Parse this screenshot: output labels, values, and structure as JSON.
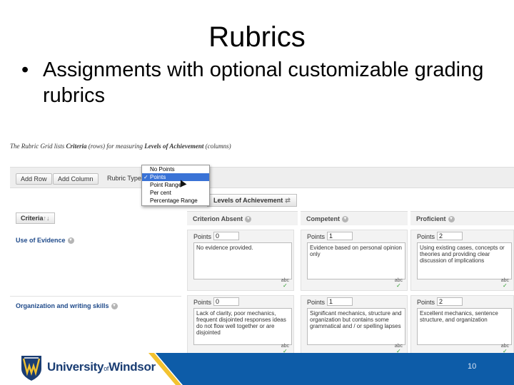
{
  "slide": {
    "title": "Rubrics",
    "bullet": "Assignments with optional customizable grading rubrics",
    "page_number": "10"
  },
  "screenshot": {
    "intro": {
      "p1": "The Rubric Grid lists ",
      "criteria": "Criteria",
      "p2": " (rows) for measuring ",
      "levels": "Levels of Achievement",
      "p3": " (columns)"
    },
    "toolbar": {
      "add_row": "Add Row",
      "add_column": "Add Column",
      "rubric_type_label": "Rubric Type"
    },
    "rubric_type_options": [
      "No Points",
      "Points",
      "Point Range",
      "Per cent",
      "Percentage Range"
    ],
    "rubric_type_selected_index": 1,
    "levels_button": "Levels of Achievement",
    "criteria_button": "Criteria",
    "columns": [
      "Criterion Absent",
      "Competent",
      "Proficient"
    ],
    "rows": [
      {
        "label": "Use of Evidence",
        "cells": [
          {
            "points_label": "Points",
            "points": "0",
            "description": "No evidence provided."
          },
          {
            "points_label": "Points",
            "points": "1",
            "description": "Evidence based on personal opinion only"
          },
          {
            "points_label": "Points",
            "points": "2",
            "description": "Using existing cases, concepts or theories and providing clear discussion of implications"
          }
        ]
      },
      {
        "label": "Organization and writing skills",
        "cells": [
          {
            "points_label": "Points",
            "points": "0",
            "description": "Lack of clarity, poor mechanics, frequent disjointed responses ideas do not flow well together or are disjointed"
          },
          {
            "points_label": "Points",
            "points": "1",
            "description": "Significant mechanics, structure and organization but contains some grammatical and / or spelling lapses"
          },
          {
            "points_label": "Points",
            "points": "2",
            "description": "Excellent mechanics, sentence structure, and organization"
          }
        ]
      }
    ],
    "spellcheck_label": "abc"
  },
  "branding": {
    "university_prefix": "University",
    "of": "of",
    "university_suffix": "Windsor"
  },
  "colors": {
    "brand_blue": "#1a3d73",
    "band_blue": "#0d5ca8",
    "band_gold": "#f2c230",
    "select_blue": "#3a73d6"
  },
  "icons": {
    "bullet": "bullet-dot-icon",
    "check": "checkmark-icon",
    "swap": "swap-arrows-icon",
    "sort": "sort-arrows-icon",
    "dropdown": "chevron-down-circle-icon",
    "logo": "windsor-shield-icon"
  }
}
